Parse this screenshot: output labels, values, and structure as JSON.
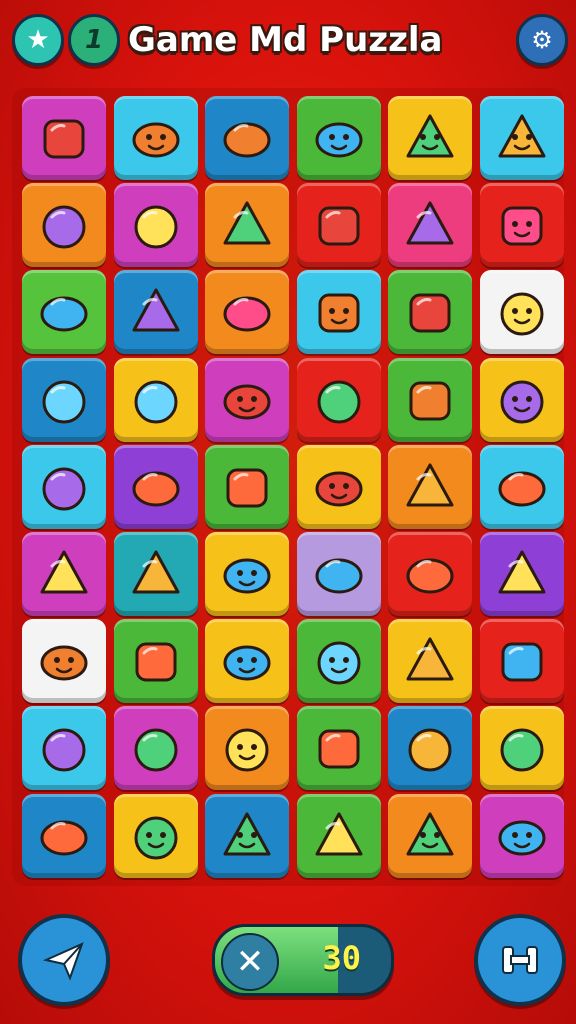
{
  "header": {
    "title": "Game Md Puzzla",
    "level_badge": "1"
  },
  "footer": {
    "moves_count": "30",
    "moves_fill_fraction": 0.7
  },
  "colors": {
    "background": "#d8120c",
    "purple": "#8e3fd6",
    "cyan": "#3cc8ea",
    "blue": "#1f87c8",
    "green": "#4bb83a",
    "yellow": "#f6c21a",
    "orange": "#f28a1e",
    "magenta": "#cf3fbd",
    "red": "#e5231c",
    "pink": "#ee3d7e",
    "lime": "#55c43c",
    "white": "#f4f4f4",
    "teal": "#22a9b4",
    "lilac": "#b69ae0"
  },
  "board": {
    "rows": [
      [
        {
          "c": "magenta",
          "i": "suitcase-icon"
        },
        {
          "c": "cyan",
          "i": "orange-lion-icon"
        },
        {
          "c": "blue",
          "i": "red-box-icon"
        },
        {
          "c": "green",
          "i": "monkey-icon"
        },
        {
          "c": "yellow",
          "i": "cat-face-icon"
        },
        {
          "c": "cyan",
          "i": "orange-blob-icon"
        }
      ],
      [
        {
          "c": "orange",
          "i": "bottle-icon"
        },
        {
          "c": "magenta",
          "i": "bucket-icon"
        },
        {
          "c": "orange",
          "i": "stack-icon"
        },
        {
          "c": "red",
          "i": "target-icon"
        },
        {
          "c": "pink",
          "i": "rocket-icon"
        },
        {
          "c": "red",
          "i": "bird-icon"
        }
      ],
      [
        {
          "c": "lime",
          "i": "carrot-icon"
        },
        {
          "c": "blue",
          "i": "sock-icon"
        },
        {
          "c": "orange",
          "i": "potion-icon"
        },
        {
          "c": "cyan",
          "i": "purple-fish-icon"
        },
        {
          "c": "green",
          "i": "glue-icon"
        },
        {
          "c": "white",
          "i": "green-slime-icon"
        }
      ],
      [
        {
          "c": "blue",
          "i": "brush-icon"
        },
        {
          "c": "yellow",
          "i": "robot-icon"
        },
        {
          "c": "magenta",
          "i": "pink-monster-icon"
        },
        {
          "c": "red",
          "i": "pineapple-icon"
        },
        {
          "c": "green",
          "i": "noodle-box-icon"
        },
        {
          "c": "yellow",
          "i": "flower-fish-icon"
        }
      ],
      [
        {
          "c": "cyan",
          "i": "gear-ring-icon"
        },
        {
          "c": "purple",
          "i": "camera-box-icon"
        },
        {
          "c": "green",
          "i": "radish-icon"
        },
        {
          "c": "yellow",
          "i": "wink-face-icon"
        },
        {
          "c": "orange",
          "i": "green-bottle-icon"
        },
        {
          "c": "cyan",
          "i": "red-ball-icon"
        }
      ],
      [
        {
          "c": "magenta",
          "i": "bread-icon"
        },
        {
          "c": "teal",
          "i": "planet-icon"
        },
        {
          "c": "yellow",
          "i": "pink-cat-icon"
        },
        {
          "c": "lilac",
          "i": "lemon-icon"
        },
        {
          "c": "red",
          "i": "strawberry-icon"
        },
        {
          "c": "purple",
          "i": "sun-icon"
        }
      ],
      [
        {
          "c": "white",
          "i": "blue-fish-icon"
        },
        {
          "c": "green",
          "i": "pencil-icon"
        },
        {
          "c": "yellow",
          "i": "ghost-icon"
        },
        {
          "c": "green",
          "i": "dog-face-icon"
        },
        {
          "c": "yellow",
          "i": "mushroom-icon"
        },
        {
          "c": "red",
          "i": "coin-icon"
        }
      ],
      [
        {
          "c": "cyan",
          "i": "crayon-icon"
        },
        {
          "c": "magenta",
          "i": "hat-cake-icon"
        },
        {
          "c": "orange",
          "i": "green-bug-icon"
        },
        {
          "c": "green",
          "i": "cube-icon"
        },
        {
          "c": "blue",
          "i": "cupcake-icon"
        },
        {
          "c": "yellow",
          "i": "blue-egg-icon"
        }
      ],
      [
        {
          "c": "blue",
          "i": "orange-compass-icon"
        },
        {
          "c": "yellow",
          "i": "wink-chick-icon"
        },
        {
          "c": "blue",
          "i": "cat-face-icon"
        },
        {
          "c": "green",
          "i": "leaf-gem-icon"
        },
        {
          "c": "orange",
          "i": "cat-face-icon"
        },
        {
          "c": "magenta",
          "i": "fox-face-icon"
        }
      ]
    ]
  }
}
